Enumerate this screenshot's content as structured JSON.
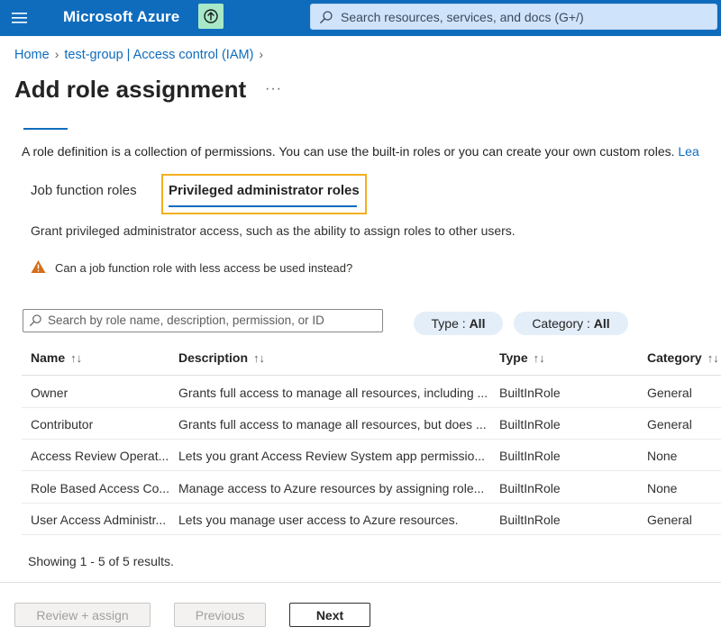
{
  "header": {
    "brand": "Microsoft Azure",
    "search_placeholder": "Search resources, services, and docs (G+/)"
  },
  "breadcrumb": [
    "Home",
    "test-group | Access control (IAM)"
  ],
  "page": {
    "title": "Add role assignment",
    "more": "···",
    "intro": "A role definition is a collection of permissions. You can use the built-in roles or you can create your own custom roles.",
    "intro_link": "Lea"
  },
  "subtabs": [
    "Job function roles",
    "Privileged administrator roles"
  ],
  "description": "Grant privileged administrator access, such as the ability to assign roles to other users.",
  "warning": "Can a job function role with less access be used instead?",
  "filter": {
    "search_placeholder": "Search by role name, description, permission, or ID",
    "type_label": "Type : ",
    "type_value": "All",
    "category_label": "Category : ",
    "category_value": "All"
  },
  "table": {
    "headers": [
      "Name",
      "Description",
      "Type",
      "Category"
    ],
    "sort_glyph": "↑↓",
    "rows": [
      {
        "name": "Owner",
        "description": "Grants full access to manage all resources, including ...",
        "type": "BuiltInRole",
        "category": "General"
      },
      {
        "name": "Contributor",
        "description": "Grants full access to manage all resources, but does ...",
        "type": "BuiltInRole",
        "category": "General"
      },
      {
        "name": "Access Review Operat...",
        "description": "Lets you grant Access Review System app permissio...",
        "type": "BuiltInRole",
        "category": "None"
      },
      {
        "name": "Role Based Access Co...",
        "description": "Manage access to Azure resources by assigning role...",
        "type": "BuiltInRole",
        "category": "None"
      },
      {
        "name": "User Access Administr...",
        "description": "Lets you manage user access to Azure resources.",
        "type": "BuiltInRole",
        "category": "General"
      }
    ]
  },
  "status": "Showing 1 - 5 of 5 results.",
  "footer": {
    "review_label": "Review + assign",
    "previous_label": "Previous",
    "next_label": "Next"
  },
  "colors": {
    "accent": "#0f6cbd",
    "highlight": "#f2b01e",
    "warning": "#d46e1a"
  }
}
